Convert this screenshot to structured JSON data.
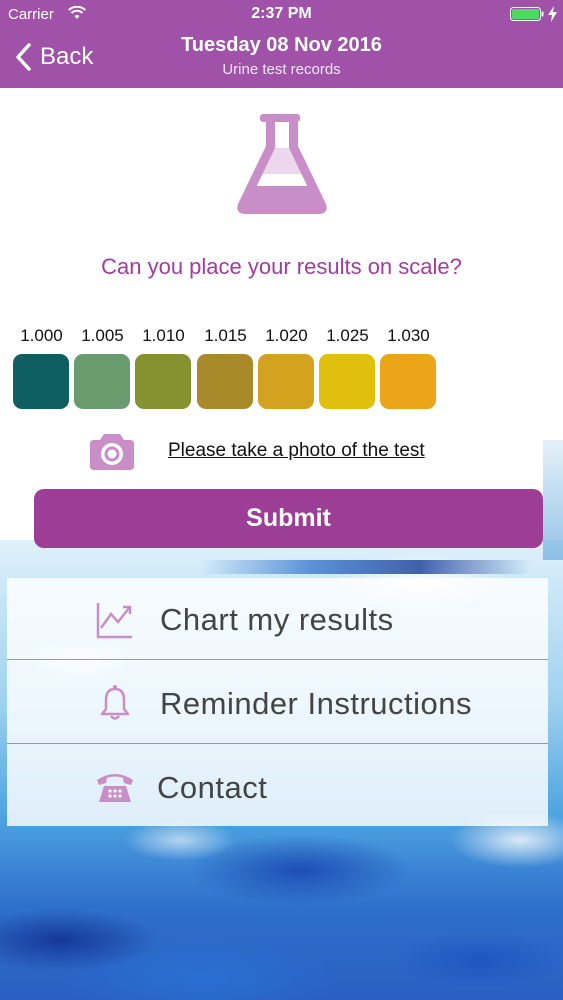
{
  "status_bar": {
    "carrier": "Carrier",
    "time": "2:37 PM"
  },
  "nav": {
    "back_label": "Back",
    "title": "Tuesday 08 Nov 2016",
    "subtitle": "Urine test records"
  },
  "main": {
    "question": "Can you place your results on scale?",
    "scale": [
      {
        "label": "1.000",
        "color": "#0f5f61"
      },
      {
        "label": "1.005",
        "color": "#6a9b6e"
      },
      {
        "label": "1.010",
        "color": "#84932f"
      },
      {
        "label": "1.015",
        "color": "#a88a2b"
      },
      {
        "label": "1.020",
        "color": "#d3a320"
      },
      {
        "label": "1.025",
        "color": "#e1bf0d"
      },
      {
        "label": "1.030",
        "color": "#eca419"
      }
    ],
    "photo_link": "Please take a photo of the test",
    "submit_label": "Submit"
  },
  "menu": {
    "items": [
      {
        "label": "Chart my results",
        "icon": "chart-icon"
      },
      {
        "label": "Reminder Instructions",
        "icon": "bell-icon"
      },
      {
        "label": "Contact",
        "icon": "phone-icon"
      }
    ]
  },
  "colors": {
    "brand": "#a052a8",
    "accent": "#9c3d96",
    "icon": "#c98dc8"
  }
}
